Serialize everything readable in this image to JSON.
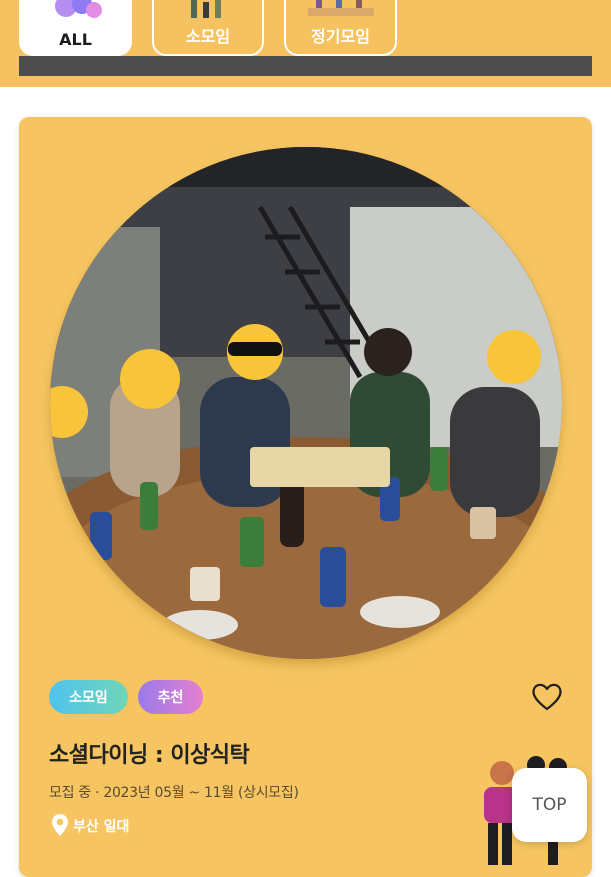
{
  "tabs": [
    {
      "label": "ALL",
      "active": true
    },
    {
      "label": "소모임",
      "active": false
    },
    {
      "label": "정기모임",
      "active": false
    }
  ],
  "card": {
    "tags": [
      "소모임",
      "추천"
    ],
    "title": "소셜다이닝 : 이상식탁",
    "period": "모집 중 · 2023년 05월 ~ 11월 (상시모집)",
    "location": "부산 일대"
  },
  "top_button": {
    "label": "TOP"
  },
  "colors": {
    "accent": "#f6c25f",
    "tag_small": "#4fc3f0",
    "tag_recommend": "#9a7be8"
  },
  "icons": [
    "heart-icon",
    "location-pin-icon"
  ]
}
